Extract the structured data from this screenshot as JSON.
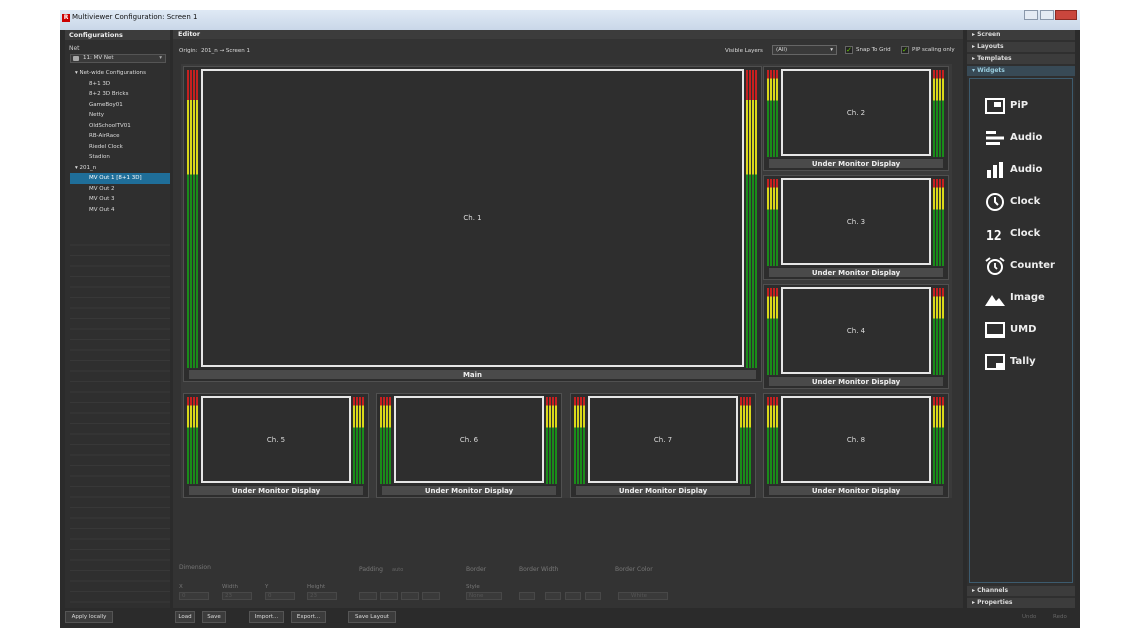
{
  "window": {
    "title": "Multiviewer Configuration: Screen 1"
  },
  "left_panel": {
    "header": "Configurations",
    "net_label": "Net",
    "net_value": "11: MV Net",
    "tree": [
      {
        "label": "▾ Net-wide Configurations",
        "indent": 1
      },
      {
        "label": "8+1 3D",
        "indent": 2
      },
      {
        "label": "8+2 3D Bricks",
        "indent": 2
      },
      {
        "label": "GameBoy01",
        "indent": 2
      },
      {
        "label": "Netty",
        "indent": 2
      },
      {
        "label": "OldSchoolTV01",
        "indent": 2
      },
      {
        "label": "RB-AirRace",
        "indent": 2
      },
      {
        "label": "Riedel Clock",
        "indent": 2
      },
      {
        "label": "Stadion",
        "indent": 2
      },
      {
        "label": "▾ 201_n",
        "indent": 1
      },
      {
        "label": "MV Out 1 [8+1 3D]",
        "indent": 2,
        "selected": true
      },
      {
        "label": "MV Out 2",
        "indent": 2
      },
      {
        "label": "MV Out 3",
        "indent": 2
      },
      {
        "label": "MV Out 4",
        "indent": 2
      }
    ]
  },
  "editor": {
    "header": "Editor",
    "origin_label": "Origin:",
    "origin_value": "201_n → Screen 1",
    "visible_layers_label": "Visible Layers",
    "visible_layers_value": "(All)",
    "snap_to_grid": "Snap To Grid",
    "pip_scaling": "PIP scaling only",
    "monitors": [
      {
        "label": "Ch. 1",
        "umd": "Main"
      },
      {
        "label": "Ch. 2",
        "umd": "Under Monitor Display"
      },
      {
        "label": "Ch. 3",
        "umd": "Under Monitor Display"
      },
      {
        "label": "Ch. 4",
        "umd": "Under Monitor Display"
      },
      {
        "label": "Ch. 5",
        "umd": "Under Monitor Display"
      },
      {
        "label": "Ch. 6",
        "umd": "Under Monitor Display"
      },
      {
        "label": "Ch. 7",
        "umd": "Under Monitor Display"
      },
      {
        "label": "Ch. 8",
        "umd": "Under Monitor Display"
      }
    ],
    "controls": {
      "dimension": "Dimension",
      "x": "X",
      "width": "Width",
      "y": "Y",
      "height": "Height",
      "x_val": "0",
      "width_val": "23",
      "y_val": "0",
      "height_val": "23",
      "padding": "Padding",
      "padding_auto": "auto",
      "border": "Border",
      "style": "Style",
      "style_val": "None",
      "border_width": "Border Width",
      "border_color": "Border Color",
      "border_color_val": "White"
    }
  },
  "right_panel": {
    "sections_top": [
      "Screen",
      "Layouts",
      "Templates"
    ],
    "active_section": "Widgets",
    "widgets": [
      {
        "label": "PiP",
        "icon": "pip-icon"
      },
      {
        "label": "Audio",
        "icon": "audio-horizontal-icon"
      },
      {
        "label": "Audio",
        "icon": "audio-vertical-icon"
      },
      {
        "label": "Clock",
        "icon": "analog-clock-icon"
      },
      {
        "label": "Clock",
        "icon": "digital-clock-icon"
      },
      {
        "label": "Counter",
        "icon": "alarm-clock-icon"
      },
      {
        "label": "Image",
        "icon": "image-icon"
      },
      {
        "label": "UMD",
        "icon": "umd-icon"
      },
      {
        "label": "Tally",
        "icon": "tally-icon"
      }
    ],
    "sections_bottom": [
      "Channels",
      "Properties"
    ]
  },
  "bottom_bar": {
    "apply_locally": "Apply locally",
    "load": "Load",
    "save": "Save",
    "import": "Import...",
    "export": "Export...",
    "save_layout": "Save Layout",
    "undo": "Undo",
    "redo": "Redo"
  }
}
